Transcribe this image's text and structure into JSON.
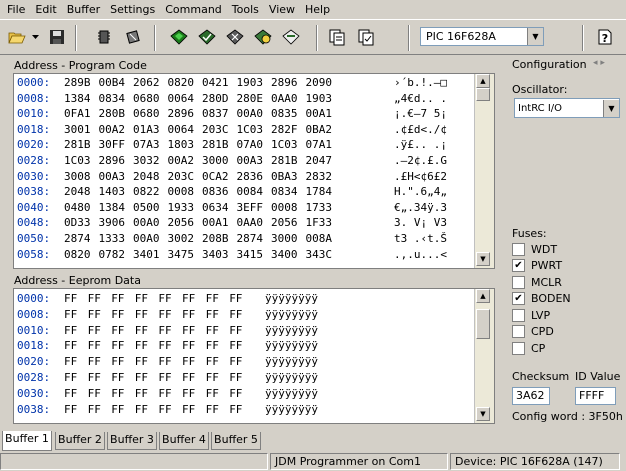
{
  "menu": [
    "File",
    "Edit",
    "Buffer",
    "Settings",
    "Command",
    "Tools",
    "View",
    "Help"
  ],
  "toolbar": {
    "device": "PIC 16F628A",
    "icons": [
      "open-icon",
      "dropdown-arrow-icon",
      "save-icon",
      "chip-icon",
      "chip-config-icon",
      "program-icon",
      "verify-icon",
      "erase-icon",
      "blank-check-icon",
      "read-icon",
      "buffer-copy-icon",
      "buffer-compare-icon",
      "help-icon"
    ]
  },
  "program_panel": {
    "header": "Address - Program Code",
    "rows": [
      {
        "addr": "0000:",
        "cells": [
          "289B",
          "00B4",
          "2062",
          "0820",
          "0421",
          "1903",
          "2896",
          "2090"
        ],
        "ascii": "›´b.!.–□"
      },
      {
        "addr": "0008:",
        "cells": [
          "1384",
          "0834",
          "0680",
          "0064",
          "280D",
          "280E",
          "0AA0",
          "1903"
        ],
        "ascii": "„4€d.. ."
      },
      {
        "addr": "0010:",
        "cells": [
          "0FA1",
          "280B",
          "0680",
          "2896",
          "0837",
          "00A0",
          "0835",
          "00A1"
        ],
        "ascii": "¡.€–7 5¡"
      },
      {
        "addr": "0018:",
        "cells": [
          "3001",
          "00A2",
          "01A3",
          "0064",
          "203C",
          "1C03",
          "282F",
          "0BA2"
        ],
        "ascii": ".¢£d<./¢"
      },
      {
        "addr": "0020:",
        "cells": [
          "281B",
          "30FF",
          "07A3",
          "1803",
          "281B",
          "07A0",
          "1C03",
          "07A1"
        ],
        "ascii": ".ÿ£.. .¡"
      },
      {
        "addr": "0028:",
        "cells": [
          "1C03",
          "2896",
          "3032",
          "00A2",
          "3000",
          "00A3",
          "281B",
          "2047"
        ],
        "ascii": ".–2¢.£.G"
      },
      {
        "addr": "0030:",
        "cells": [
          "3008",
          "00A3",
          "2048",
          "203C",
          "0CA2",
          "2836",
          "0BA3",
          "2832"
        ],
        "ascii": ".£H<¢6£2"
      },
      {
        "addr": "0038:",
        "cells": [
          "2048",
          "1403",
          "0822",
          "0008",
          "0836",
          "0084",
          "0834",
          "1784"
        ],
        "ascii": "H.\".6„4„"
      },
      {
        "addr": "0040:",
        "cells": [
          "0480",
          "1384",
          "0500",
          "1933",
          "0634",
          "3EFF",
          "0008",
          "1733"
        ],
        "ascii": "€„.34ÿ.3"
      },
      {
        "addr": "0048:",
        "cells": [
          "0D33",
          "3906",
          "00A0",
          "2056",
          "00A1",
          "0AA0",
          "2056",
          "1F33"
        ],
        "ascii": "3. V¡ V3"
      },
      {
        "addr": "0050:",
        "cells": [
          "2874",
          "1333",
          "00A0",
          "3002",
          "208B",
          "2874",
          "3000",
          "008A"
        ],
        "ascii": "t3 .‹t.Š"
      },
      {
        "addr": "0058:",
        "cells": [
          "0820",
          "0782",
          "3401",
          "3475",
          "3403",
          "3415",
          "3400",
          "343C"
        ],
        "ascii": ".‚.u...<"
      }
    ]
  },
  "eeprom_panel": {
    "header": "Address - Eeprom Data",
    "rows": [
      {
        "addr": "0000:",
        "cells": [
          "FF",
          "FF",
          "FF",
          "FF",
          "FF",
          "FF",
          "FF",
          "FF"
        ],
        "ascii": "ÿÿÿÿÿÿÿÿ"
      },
      {
        "addr": "0008:",
        "cells": [
          "FF",
          "FF",
          "FF",
          "FF",
          "FF",
          "FF",
          "FF",
          "FF"
        ],
        "ascii": "ÿÿÿÿÿÿÿÿ"
      },
      {
        "addr": "0010:",
        "cells": [
          "FF",
          "FF",
          "FF",
          "FF",
          "FF",
          "FF",
          "FF",
          "FF"
        ],
        "ascii": "ÿÿÿÿÿÿÿÿ"
      },
      {
        "addr": "0018:",
        "cells": [
          "FF",
          "FF",
          "FF",
          "FF",
          "FF",
          "FF",
          "FF",
          "FF"
        ],
        "ascii": "ÿÿÿÿÿÿÿÿ"
      },
      {
        "addr": "0020:",
        "cells": [
          "FF",
          "FF",
          "FF",
          "FF",
          "FF",
          "FF",
          "FF",
          "FF"
        ],
        "ascii": "ÿÿÿÿÿÿÿÿ"
      },
      {
        "addr": "0028:",
        "cells": [
          "FF",
          "FF",
          "FF",
          "FF",
          "FF",
          "FF",
          "FF",
          "FF"
        ],
        "ascii": "ÿÿÿÿÿÿÿÿ"
      },
      {
        "addr": "0030:",
        "cells": [
          "FF",
          "FF",
          "FF",
          "FF",
          "FF",
          "FF",
          "FF",
          "FF"
        ],
        "ascii": "ÿÿÿÿÿÿÿÿ"
      },
      {
        "addr": "0038:",
        "cells": [
          "FF",
          "FF",
          "FF",
          "FF",
          "FF",
          "FF",
          "FF",
          "FF"
        ],
        "ascii": "ÿÿÿÿÿÿÿÿ"
      }
    ]
  },
  "config": {
    "title": "Configuration",
    "oscillator_label": "Oscillator:",
    "oscillator_value": "IntRC I/O",
    "fuses_label": "Fuses:",
    "fuses": [
      {
        "name": "WDT",
        "checked": false
      },
      {
        "name": "PWRT",
        "checked": true
      },
      {
        "name": "MCLR",
        "checked": false
      },
      {
        "name": "BODEN",
        "checked": true
      },
      {
        "name": "LVP",
        "checked": false
      },
      {
        "name": "CPD",
        "checked": false
      },
      {
        "name": "CP",
        "checked": false
      }
    ],
    "checksum_label": "Checksum",
    "checksum_value": "3A62",
    "id_label": "ID Value",
    "id_value": "FFFF",
    "config_word": "Config word : 3F50h"
  },
  "tabs": [
    "Buffer 1",
    "Buffer 2",
    "Buffer 3",
    "Buffer 4",
    "Buffer 5"
  ],
  "active_tab": 0,
  "status": [
    "",
    "JDM Programmer on Com1",
    "Device: PIC 16F628A  (147)"
  ],
  "colors": {
    "address": "#0033aa",
    "window": "#d4d0c8"
  }
}
